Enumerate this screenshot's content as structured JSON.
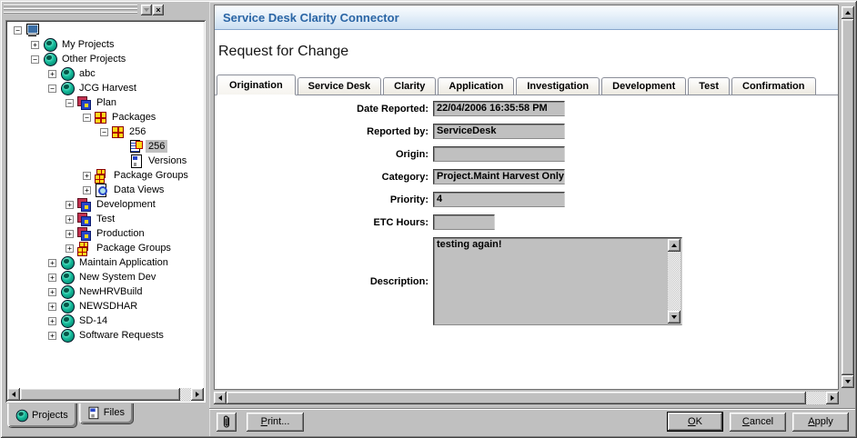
{
  "left_panel": {
    "titlebar": {
      "rollup_tooltip": "collapse",
      "close_label": "x"
    },
    "tree": {
      "items": [
        {
          "label": "",
          "icon": "computer",
          "level": 0,
          "expand": "-"
        },
        {
          "label": "My Projects",
          "icon": "globe",
          "level": 1,
          "expand": "+"
        },
        {
          "label": "Other Projects",
          "icon": "globe",
          "level": 1,
          "expand": "-"
        },
        {
          "label": "abc",
          "icon": "globe",
          "level": 2,
          "expand": "+"
        },
        {
          "label": "JCG Harvest",
          "icon": "globe",
          "level": 2,
          "expand": "-"
        },
        {
          "label": "Plan",
          "icon": "cube",
          "level": 3,
          "expand": "-"
        },
        {
          "label": "Packages",
          "icon": "package",
          "level": 4,
          "expand": "-"
        },
        {
          "label": "256",
          "icon": "package",
          "level": 5,
          "expand": "-"
        },
        {
          "label": "256",
          "icon": "package-version",
          "level": 6,
          "expand": null,
          "selected": true
        },
        {
          "label": "Versions",
          "icon": "versions",
          "level": 6,
          "expand": null
        },
        {
          "label": "Package Groups",
          "icon": "package-group",
          "level": 4,
          "expand": "+"
        },
        {
          "label": "Data Views",
          "icon": "data-views",
          "level": 4,
          "expand": "+"
        },
        {
          "label": "Development",
          "icon": "cube",
          "level": 3,
          "expand": "+"
        },
        {
          "label": "Test",
          "icon": "cube",
          "level": 3,
          "expand": "+"
        },
        {
          "label": "Production",
          "icon": "cube",
          "level": 3,
          "expand": "+"
        },
        {
          "label": "Package Groups",
          "icon": "package-group",
          "level": 3,
          "expand": "+"
        },
        {
          "label": "Maintain Application",
          "icon": "globe",
          "level": 2,
          "expand": "+"
        },
        {
          "label": "New System Dev",
          "icon": "globe",
          "level": 2,
          "expand": "+"
        },
        {
          "label": "NewHRVBuild",
          "icon": "globe",
          "level": 2,
          "expand": "+"
        },
        {
          "label": "NEWSDHAR",
          "icon": "globe",
          "level": 2,
          "expand": "+"
        },
        {
          "label": "SD-14",
          "icon": "globe",
          "level": 2,
          "expand": "+"
        },
        {
          "label": "Software Requests",
          "icon": "globe",
          "level": 2,
          "expand": "+"
        }
      ]
    },
    "tabs": [
      {
        "label": "Projects",
        "icon": "globe",
        "active": true
      },
      {
        "label": "Files",
        "icon": "file",
        "active": false
      }
    ]
  },
  "main": {
    "header_title": "Service Desk Clarity Connector",
    "page_title": "Request for Change",
    "tabs": [
      {
        "label": "Origination",
        "active": true
      },
      {
        "label": "Service Desk"
      },
      {
        "label": "Clarity"
      },
      {
        "label": "Application"
      },
      {
        "label": "Investigation"
      },
      {
        "label": "Development"
      },
      {
        "label": "Test"
      },
      {
        "label": "Confirmation"
      }
    ],
    "form": {
      "fields": [
        {
          "label": "Date Reported:",
          "value": "22/04/2006 16:35:58 PM"
        },
        {
          "label": "Reported by:",
          "value": "ServiceDesk"
        },
        {
          "label": "Origin:",
          "value": ""
        },
        {
          "label": "Category:",
          "value": "Project.Maint Harvest Only"
        },
        {
          "label": "Priority:",
          "value": "4"
        },
        {
          "label": "ETC Hours:",
          "value": "",
          "short": true
        }
      ],
      "description": {
        "label": "Description:",
        "value": "testing again!"
      }
    },
    "buttons": {
      "print": "Print...",
      "ok": "OK",
      "cancel": "Cancel",
      "apply": "Apply"
    }
  },
  "colors": {
    "header_text": "#2a65a5",
    "header_gradient_top": "#fbfdff",
    "header_gradient_bottom": "#cbdff2",
    "header_underline": "#87a6cb",
    "window_gray": "#c0c0c0",
    "selection_bg": "#c0c0c0"
  }
}
